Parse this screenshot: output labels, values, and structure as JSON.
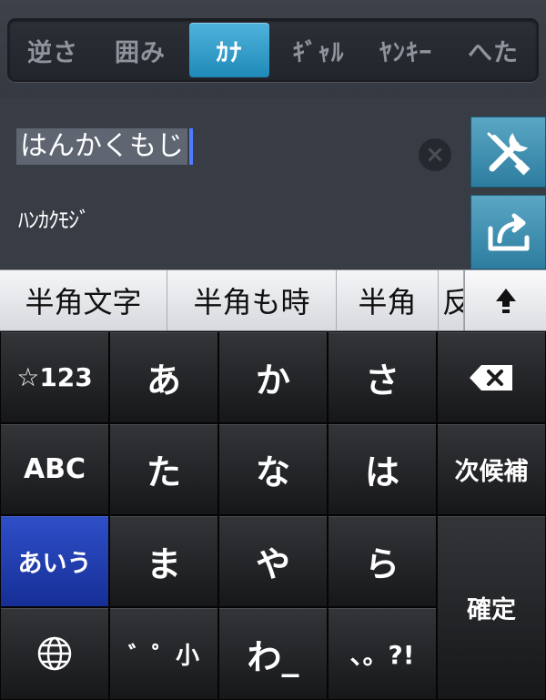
{
  "tabs": [
    {
      "label": "逆さ",
      "active": false
    },
    {
      "label": "囲み",
      "active": false
    },
    {
      "label": "ｶﾅ",
      "active": true
    },
    {
      "label": "ｷﾞｬﾙ",
      "active": false
    },
    {
      "label": "ﾔﾝｷｰ",
      "active": false
    },
    {
      "label": "へた",
      "active": false
    }
  ],
  "input": {
    "text": "はんかくもじ",
    "clear_symbol": "×"
  },
  "converted": "ﾊﾝｶｸﾓｼﾞ",
  "candidates": [
    "半角文字",
    "半角も時",
    "半角",
    "反"
  ],
  "keyboard": {
    "row1": {
      "mode": "☆123",
      "k1": "あ",
      "k2": "か",
      "k3": "さ"
    },
    "row2": {
      "mode": "ABC",
      "k1": "た",
      "k2": "な",
      "k3": "は",
      "right": "次候補"
    },
    "row3": {
      "mode": "あいう",
      "k1": "ま",
      "k2": "や",
      "k3": "ら"
    },
    "row4": {
      "k1": "゛゜小",
      "k2": "わ_",
      "k3": "、。?!"
    },
    "confirm": "確定"
  },
  "colors": {
    "accent": "#2a97c7",
    "side_button": "#3d8fb2",
    "active_mode_key": "#1f3aa8",
    "caret": "#4f7cff"
  },
  "icons": {
    "tools": "wrench-screwdriver-icon",
    "share": "share-icon",
    "clear": "clear-icon",
    "shift": "shift-arrow-icon",
    "delete": "backspace-icon",
    "globe": "globe-icon"
  }
}
